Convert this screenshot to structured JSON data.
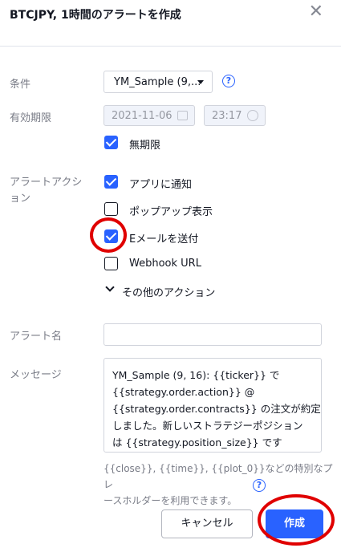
{
  "dialog": {
    "title": "BTCJPY, 1時間のアラートを作成",
    "close_glyph": "✕"
  },
  "condition": {
    "label": "条件",
    "selected": "YM_Sample (9,...",
    "help_glyph": "?"
  },
  "expiration": {
    "label": "有効期限",
    "date": "2021-11-06",
    "time": "23:17",
    "unlimited_label": "無期限",
    "unlimited_checked": true
  },
  "actions": {
    "label_line1": "アラートアクシ",
    "label_line2": "ョン",
    "items": [
      {
        "label": "アプリに通知",
        "checked": true
      },
      {
        "label": "ポップアップ表示",
        "checked": false
      },
      {
        "label": "Eメールを送付",
        "checked": true
      },
      {
        "label": "Webhook URL",
        "checked": false
      }
    ],
    "more_label": "その他のアクション"
  },
  "alert_name": {
    "label": "アラート名",
    "value": ""
  },
  "message": {
    "label": "メッセージ",
    "lines": [
      "YM_Sample (9, 16): {{ticker}} で",
      "{{strategy.order.action}} @",
      "{{strategy.order.contracts}} の注文が約定",
      "しました。新しいストラテジーポジション",
      "は {{strategy.position_size}} です"
    ]
  },
  "hint": {
    "line1": "{{close}}, {{time}}, {{plot_0}}などの特別なプレ",
    "line2": "ースホルダーを利用できます。",
    "help_glyph": "?"
  },
  "buttons": {
    "cancel": "キャンセル",
    "create": "作成"
  },
  "colors": {
    "accent": "#2962ff",
    "annotation": "#e00000"
  }
}
